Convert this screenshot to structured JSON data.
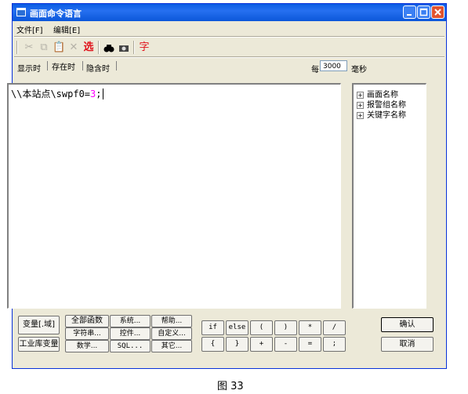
{
  "window": {
    "title": "画面命令语言"
  },
  "menu": [
    "文件[F]",
    "编辑[E]"
  ],
  "toolbar": {
    "items": [
      "cut",
      "copy",
      "paste",
      "delete",
      "select",
      "find",
      "replace",
      "font"
    ],
    "select_label": "选",
    "font_label": "字"
  },
  "tabs": [
    {
      "label": "显示时",
      "active": false
    },
    {
      "label": "存在时",
      "active": true
    },
    {
      "label": "隐含时",
      "active": false
    }
  ],
  "interval": {
    "prefix": "每",
    "value": "3000",
    "unit": "毫秒"
  },
  "editor": {
    "code_text": "\\\\本站点\\swpf0=",
    "code_number": "3",
    "code_end": ";"
  },
  "tree": [
    {
      "label": "画面名称",
      "expander": "+"
    },
    {
      "label": "报警组名称",
      "expander": "+"
    },
    {
      "label": "关键字名称",
      "expander": "+"
    }
  ],
  "buttons": {
    "variable": "变量[.域]",
    "library_var": "工业库变量",
    "all_functions": "全部函数",
    "string": "字符串...",
    "math": "数学...",
    "system": "系统...",
    "control": "控件...",
    "sql": "SQL...",
    "help": "帮助...",
    "custom": "自定义...",
    "other": "其它...",
    "confirm": "确认",
    "cancel": "取消"
  },
  "operators_row1": [
    "if",
    "else",
    "(",
    ")",
    "*",
    "/"
  ],
  "operators_row2": [
    "{",
    "}",
    "+",
    "-",
    "=",
    ";"
  ],
  "caption": "图 33"
}
